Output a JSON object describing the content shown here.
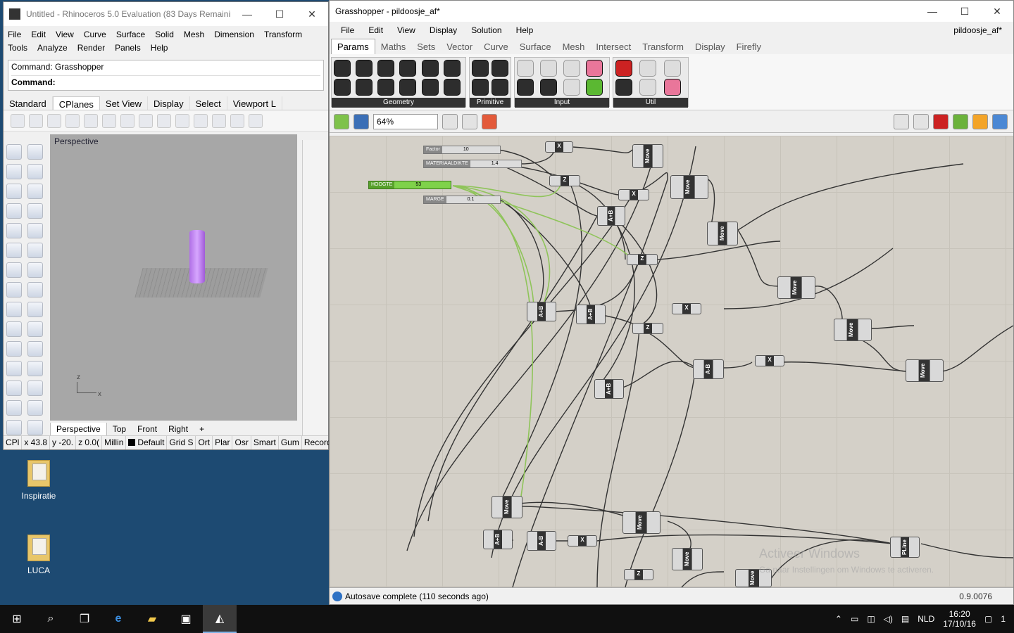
{
  "desktop": {
    "icons": [
      {
        "label": "Inspiratie"
      },
      {
        "label": "LUCA"
      }
    ]
  },
  "rhino": {
    "title": "Untitled - Rhinoceros 5.0 Evaluation (83 Days Remainin...",
    "menu": [
      "File",
      "Edit",
      "View",
      "Curve",
      "Surface",
      "Solid",
      "Mesh",
      "Dimension",
      "Transform",
      "Tools",
      "Analyze",
      "Render",
      "Panels",
      "Help"
    ],
    "command_history": "Command: Grasshopper",
    "command_prompt": "Command:",
    "toolbar_tabs": [
      "Standard",
      "CPlanes",
      "Set View",
      "Display",
      "Select",
      "Viewport L"
    ],
    "active_tab": "CPlanes",
    "viewport_label": "Perspective",
    "viewport_tabs": [
      "Perspective",
      "Top",
      "Front",
      "Right"
    ],
    "axis_z": "z",
    "axis_x": "x",
    "status": [
      "CPl",
      "x 43.8",
      "y -20.",
      "z 0.0(",
      "Millin",
      "Default",
      "Grid S",
      "Ort",
      "Plar",
      "Osr",
      "Smart",
      "Gum",
      "Record"
    ]
  },
  "grasshopper": {
    "title": "Grasshopper - pildoosje_af*",
    "menu": [
      "File",
      "Edit",
      "View",
      "Display",
      "Solution",
      "Help"
    ],
    "document_name": "pildoosje_af*",
    "tabs": [
      "Params",
      "Maths",
      "Sets",
      "Vector",
      "Curve",
      "Surface",
      "Mesh",
      "Intersect",
      "Transform",
      "Display",
      "Firefly"
    ],
    "active_tab": "Params",
    "ribbon_groups": [
      "Geometry",
      "Primitive",
      "Input",
      "Util"
    ],
    "zoom": "64%",
    "sliders": [
      {
        "name": "Factor",
        "value": "10"
      },
      {
        "name": "MATERIAALDIKTE",
        "value": "1.4"
      },
      {
        "name": "HOOGTE",
        "value": "53"
      },
      {
        "name": "MARGE",
        "value": "0.1"
      }
    ],
    "components": {
      "move": "Move",
      "addition": "A+B",
      "subtraction": "A-B",
      "unit_x": "X",
      "unit_z": "Z",
      "polyline": "PLine"
    },
    "status_message": "Autosave complete (110 seconds ago)",
    "version": "0.9.0076",
    "watermark_title": "Activeer Windows",
    "watermark_text": "Ga naar Instellingen om Windows te activeren."
  },
  "taskbar": {
    "language": "NLD",
    "time": "16:20",
    "date": "17/10/16",
    "notifications": "1"
  }
}
